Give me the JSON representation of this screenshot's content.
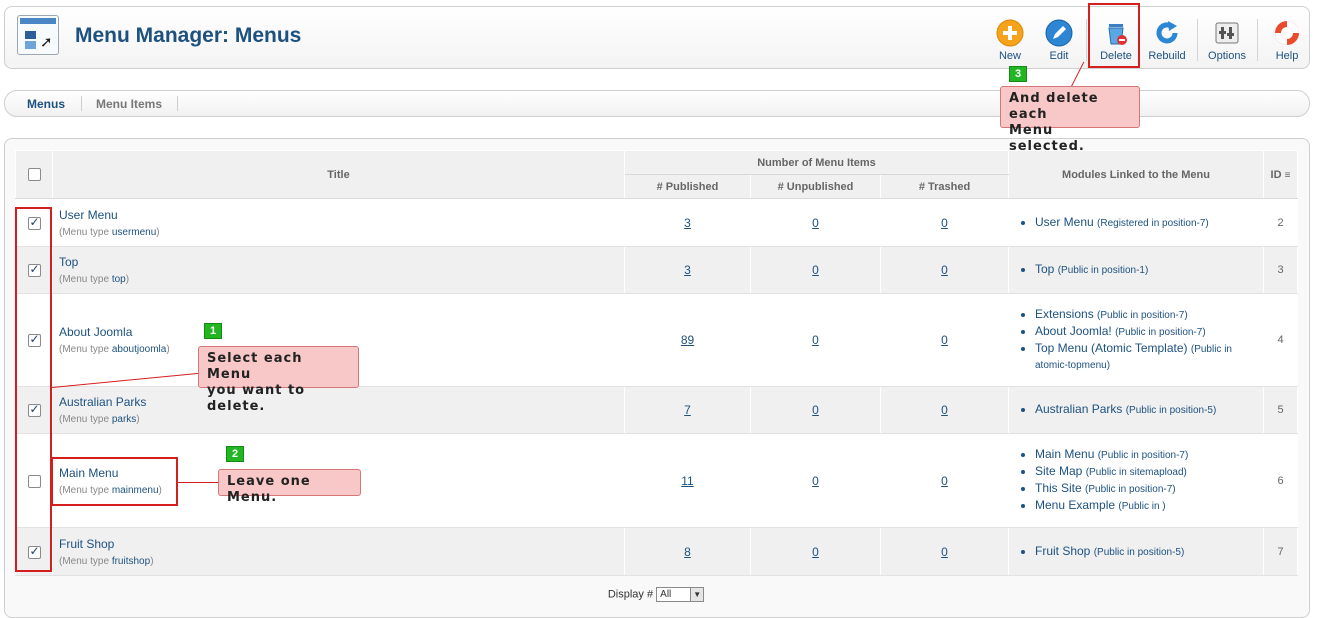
{
  "header": {
    "title": "Menu Manager: Menus",
    "toolbar": [
      {
        "label": "New",
        "icon": "plus-circle-icon"
      },
      {
        "label": "Edit",
        "icon": "pencil-icon"
      },
      {
        "label": "Delete",
        "icon": "trash-icon"
      },
      {
        "label": "Rebuild",
        "icon": "refresh-icon"
      },
      {
        "label": "Options",
        "icon": "options-icon"
      },
      {
        "label": "Help",
        "icon": "lifebuoy-icon"
      }
    ]
  },
  "submenu": {
    "tabs": [
      "Menus",
      "Menu Items"
    ]
  },
  "table": {
    "headers": {
      "title": "Title",
      "number_group": "Number of Menu Items",
      "published": "# Published",
      "unpublished": "# Unpublished",
      "trashed": "# Trashed",
      "modules": "Modules Linked to the Menu",
      "id": "ID"
    },
    "menu_type_prefix": "Menu type",
    "rows": [
      {
        "title": "User Menu",
        "type": "usermenu",
        "checked": true,
        "published": "3",
        "unpublished": "0",
        "trashed": "0",
        "modules": [
          {
            "name": "User Menu",
            "pos": "(Registered in position-7)"
          }
        ],
        "id": "2"
      },
      {
        "title": "Top",
        "type": "top",
        "checked": true,
        "published": "3",
        "unpublished": "0",
        "trashed": "0",
        "modules": [
          {
            "name": "Top",
            "pos": "(Public in position-1)"
          }
        ],
        "id": "3"
      },
      {
        "title": "About Joomla",
        "type": "aboutjoomla",
        "checked": true,
        "published": "89",
        "unpublished": "0",
        "trashed": "0",
        "modules": [
          {
            "name": "Extensions",
            "pos": "(Public in position-7)"
          },
          {
            "name": "About Joomla!",
            "pos": "(Public in position-7)"
          },
          {
            "name": "Top Menu (Atomic Template)",
            "pos": "(Public in atomic-topmenu)"
          }
        ],
        "id": "4"
      },
      {
        "title": "Australian Parks",
        "type": "parks",
        "checked": true,
        "published": "7",
        "unpublished": "0",
        "trashed": "0",
        "modules": [
          {
            "name": "Australian Parks",
            "pos": "(Public in position-5)"
          }
        ],
        "id": "5"
      },
      {
        "title": "Main Menu",
        "type": "mainmenu",
        "checked": false,
        "published": "11",
        "unpublished": "0",
        "trashed": "0",
        "modules": [
          {
            "name": "Main Menu",
            "pos": "(Public in position-7)"
          },
          {
            "name": "Site Map",
            "pos": "(Public in sitemapload)"
          },
          {
            "name": "This Site",
            "pos": "(Public in position-7)"
          },
          {
            "name": "Menu Example",
            "pos": "(Public in )"
          }
        ],
        "id": "6"
      },
      {
        "title": "Fruit Shop",
        "type": "fruitshop",
        "checked": true,
        "published": "8",
        "unpublished": "0",
        "trashed": "0",
        "modules": [
          {
            "name": "Fruit Shop",
            "pos": "(Public in position-5)"
          }
        ],
        "id": "7"
      }
    ]
  },
  "footer": {
    "display_label": "Display #",
    "limit_value": "All"
  },
  "annotations": {
    "step1": {
      "number": "1",
      "text_line1": "Select each Menu",
      "text_line2": "you want to delete."
    },
    "step2": {
      "number": "2",
      "text": "Leave one Menu."
    },
    "step3": {
      "number": "3",
      "text_line1": "And delete each",
      "text_line2": "Menu selected."
    }
  },
  "colors": {
    "link": "#1d5180",
    "annotation_red": "#d51f1f",
    "callout_bg": "#f8c8c8",
    "step_green": "#22b722"
  }
}
